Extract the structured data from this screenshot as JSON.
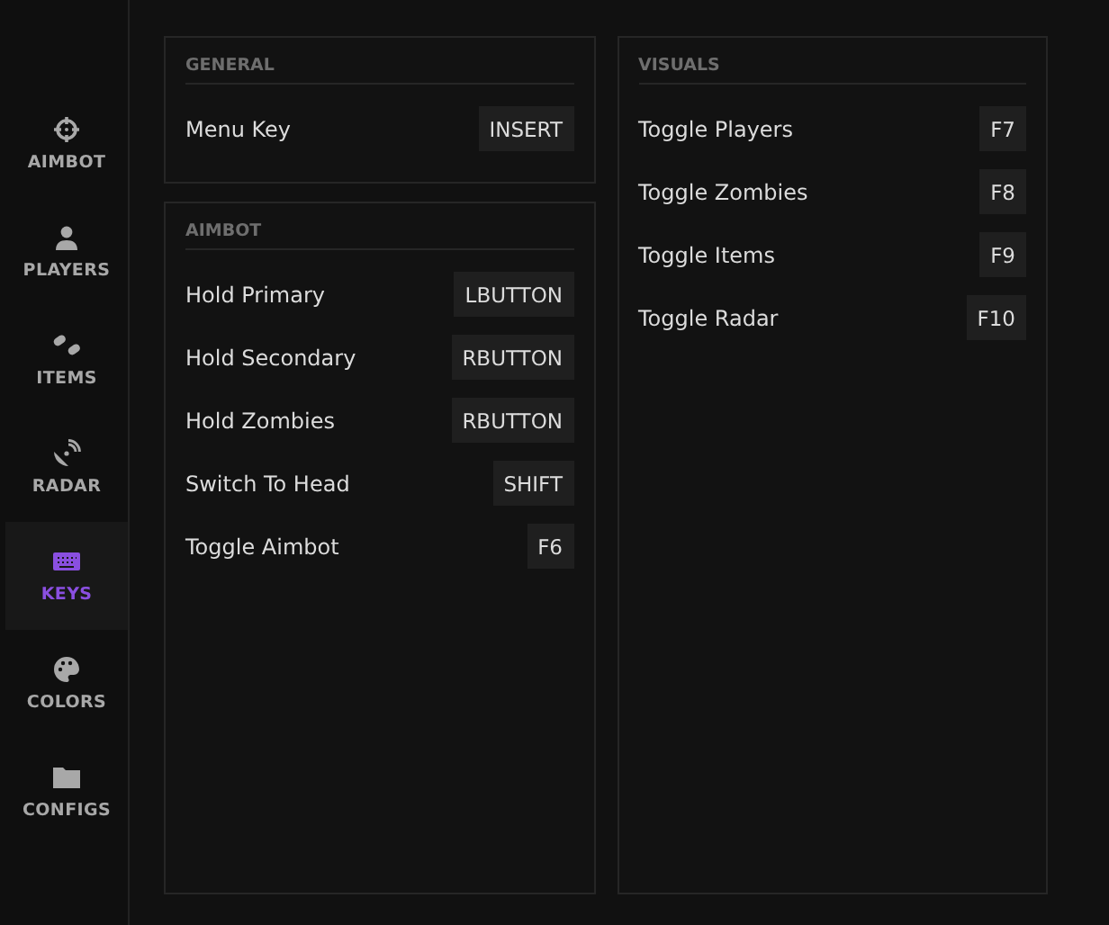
{
  "sidebar": {
    "items": [
      {
        "label": "AIMBOT",
        "kind": "crosshair",
        "selected": false
      },
      {
        "label": "PLAYERS",
        "kind": "person",
        "selected": false
      },
      {
        "label": "ITEMS",
        "kind": "pills",
        "selected": false
      },
      {
        "label": "RADAR",
        "kind": "dish",
        "selected": false
      },
      {
        "label": "KEYS",
        "kind": "keyboard",
        "selected": true
      },
      {
        "label": "COLORS",
        "kind": "palette",
        "selected": false
      },
      {
        "label": "CONFIGS",
        "kind": "folder",
        "selected": false
      }
    ]
  },
  "columns": [
    {
      "panels": [
        {
          "title": "GENERAL",
          "rows": [
            {
              "label": "Menu Key",
              "key": "INSERT"
            }
          ]
        },
        {
          "title": "AIMBOT",
          "rows": [
            {
              "label": "Hold Primary",
              "key": "LBUTTON"
            },
            {
              "label": "Hold Secondary",
              "key": "RBUTTON"
            },
            {
              "label": "Hold Zombies",
              "key": "RBUTTON"
            },
            {
              "label": "Switch To Head",
              "key": "SHIFT"
            },
            {
              "label": "Toggle Aimbot",
              "key": "F6"
            }
          ]
        }
      ]
    },
    {
      "panels": [
        {
          "title": "VISUALS",
          "rows": [
            {
              "label": "Toggle Players",
              "key": "F7"
            },
            {
              "label": "Toggle Zombies",
              "key": "F8"
            },
            {
              "label": "Toggle Items",
              "key": "F9"
            },
            {
              "label": "Toggle Radar",
              "key": "F10"
            }
          ]
        }
      ]
    }
  ]
}
